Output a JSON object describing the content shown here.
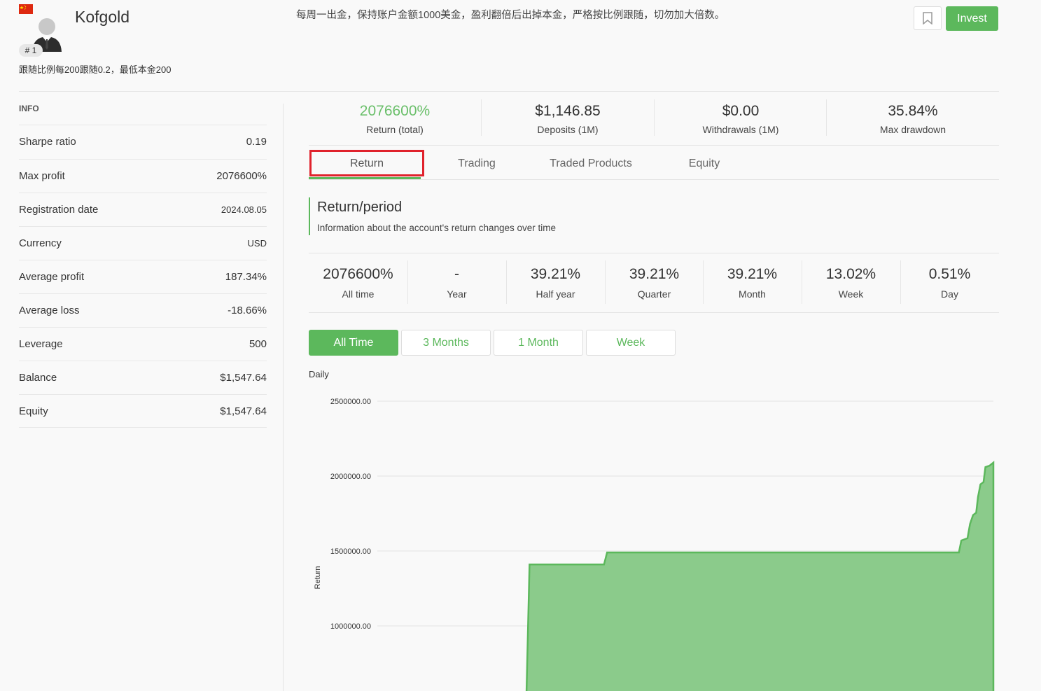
{
  "header": {
    "username": "Kofgold",
    "rank": "# 1",
    "subtitle": "跟随比例每200跟随0.2，最低本金200",
    "description": "每周一出金，保持账户金额1000美金，盈利翻倍后出掉本金，严格按比例跟随，切勿加大倍数。",
    "invest_label": "Invest",
    "icons": [
      "china-flag-icon",
      "user-avatar-icon",
      "bookmark-icon"
    ]
  },
  "info": {
    "title": "INFO",
    "rows": [
      {
        "label": "Sharpe ratio",
        "value": "0.19"
      },
      {
        "label": "Max profit",
        "value": "2076600%"
      },
      {
        "label": "Registration date",
        "value": "2024.08.05"
      },
      {
        "label": "Currency",
        "value": "USD"
      },
      {
        "label": "Average profit",
        "value": "187.34%"
      },
      {
        "label": "Average loss",
        "value": "-18.66%"
      },
      {
        "label": "Leverage",
        "value": "500"
      },
      {
        "label": "Balance",
        "value": "$1,547.64"
      },
      {
        "label": "Equity",
        "value": "$1,547.64"
      }
    ]
  },
  "stats": [
    {
      "value": "2076600%",
      "label": "Return (total)"
    },
    {
      "value": "$1,146.85",
      "label": "Deposits (1M)"
    },
    {
      "value": "$0.00",
      "label": "Withdrawals (1M)"
    },
    {
      "value": "35.84%",
      "label": "Max drawdown"
    }
  ],
  "tabs": [
    {
      "label": "Return"
    },
    {
      "label": "Trading"
    },
    {
      "label": "Traded Products"
    },
    {
      "label": "Equity"
    }
  ],
  "section": {
    "title": "Return/period",
    "subtitle": "Information about the account's return changes over time"
  },
  "period_stats": [
    {
      "value": "2076600%",
      "label": "All time"
    },
    {
      "value": "-",
      "label": "Year"
    },
    {
      "value": "39.21%",
      "label": "Half year"
    },
    {
      "value": "39.21%",
      "label": "Quarter"
    },
    {
      "value": "39.21%",
      "label": "Month"
    },
    {
      "value": "13.02%",
      "label": "Week"
    },
    {
      "value": "0.51%",
      "label": "Day"
    }
  ],
  "ranges": [
    {
      "label": "All Time"
    },
    {
      "label": "3 Months"
    },
    {
      "label": "1 Month"
    },
    {
      "label": "Week"
    }
  ],
  "colors": {
    "accent": "#5cb85c",
    "highlight": "#e0222c",
    "fill": "#8bcb8b"
  },
  "chart_data": {
    "type": "area",
    "title": "Daily",
    "ylabel": "Return",
    "xlabel": "",
    "y_ticks": [
      "2500000.00",
      "2000000.00",
      "1500000.00",
      "1000000.00"
    ],
    "ylim": [
      700000,
      2500000
    ],
    "xlim": [
      0,
      100
    ],
    "series": [
      {
        "points": [
          [
            0,
            0
          ],
          [
            24.2,
            0
          ],
          [
            24.7,
            1410000
          ],
          [
            36.8,
            1410000
          ],
          [
            37.3,
            1490000
          ],
          [
            94.4,
            1490000
          ],
          [
            94.8,
            1570000
          ],
          [
            95.8,
            1585000
          ],
          [
            96.2,
            1680000
          ],
          [
            96.7,
            1740000
          ],
          [
            97.2,
            1755000
          ],
          [
            97.5,
            1860000
          ],
          [
            97.9,
            1945000
          ],
          [
            98.4,
            1960000
          ],
          [
            98.7,
            2060000
          ],
          [
            99.4,
            2070000
          ],
          [
            100,
            2090000
          ]
        ]
      }
    ]
  }
}
